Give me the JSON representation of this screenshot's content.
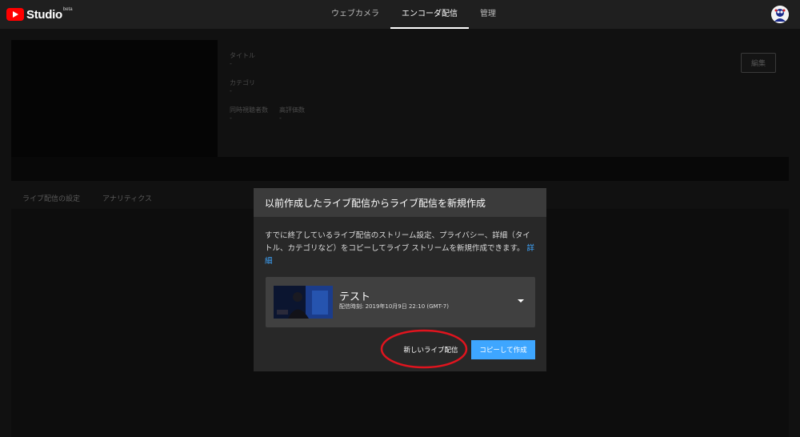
{
  "header": {
    "logo_text": "Studio",
    "logo_badge": "beta",
    "tabs": [
      {
        "label": "ウェブカメラ"
      },
      {
        "label": "エンコーダ配信"
      },
      {
        "label": "管理"
      }
    ]
  },
  "page": {
    "info": {
      "title_label": "タイトル",
      "title_value": "-",
      "category_label": "カテゴリ",
      "category_value": "-",
      "viewers_label": "同時視聴者数",
      "viewers_value": "-",
      "likes_label": "高評価数",
      "likes_value": "-"
    },
    "edit_label": "編集",
    "subtabs": [
      "ライブ配信の設定",
      "アナリティクス"
    ]
  },
  "modal": {
    "title": "以前作成したライブ配信からライブ配信を新規作成",
    "description": "すでに終了しているライブ配信のストリーム設定、プライバシー、詳細（タイトル、カテゴリなど）をコピーしてライブ ストリームを新規作成できます。",
    "more_link": "詳細",
    "selected_stream": {
      "title": "テスト",
      "subtitle": "配信時刻: 2019年10月9日 22:10 (GMT-7)"
    },
    "new_button": "新しいライブ配信",
    "copy_button": "コピーして作成"
  },
  "colors": {
    "accent": "#3ea6ff",
    "brand": "#ff0000",
    "annotation": "#e0141e"
  }
}
